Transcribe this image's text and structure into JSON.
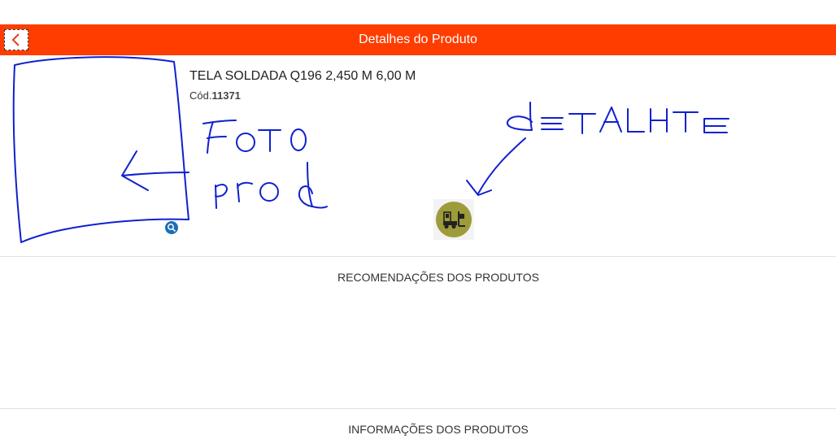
{
  "header": {
    "title": "Detalhes do Produto",
    "back_icon": "chevron-left-icon",
    "background": "#ff3d00"
  },
  "product": {
    "name": "TELA SOLDADA Q196 2,450 M 6,00 M",
    "code_label": "Cód.",
    "code": "11371",
    "zoom_icon": "magnifier-icon",
    "detail_icon": "forklift-icon"
  },
  "annotations": {
    "photo_note_line1": "foto",
    "photo_note_line2": "prod",
    "detail_note": "detalhe"
  },
  "sections": {
    "recommendations": "RECOMENDAÇÕES DOS PRODUTOS",
    "information": "INFORMAÇÕES DOS PRODUTOS"
  }
}
